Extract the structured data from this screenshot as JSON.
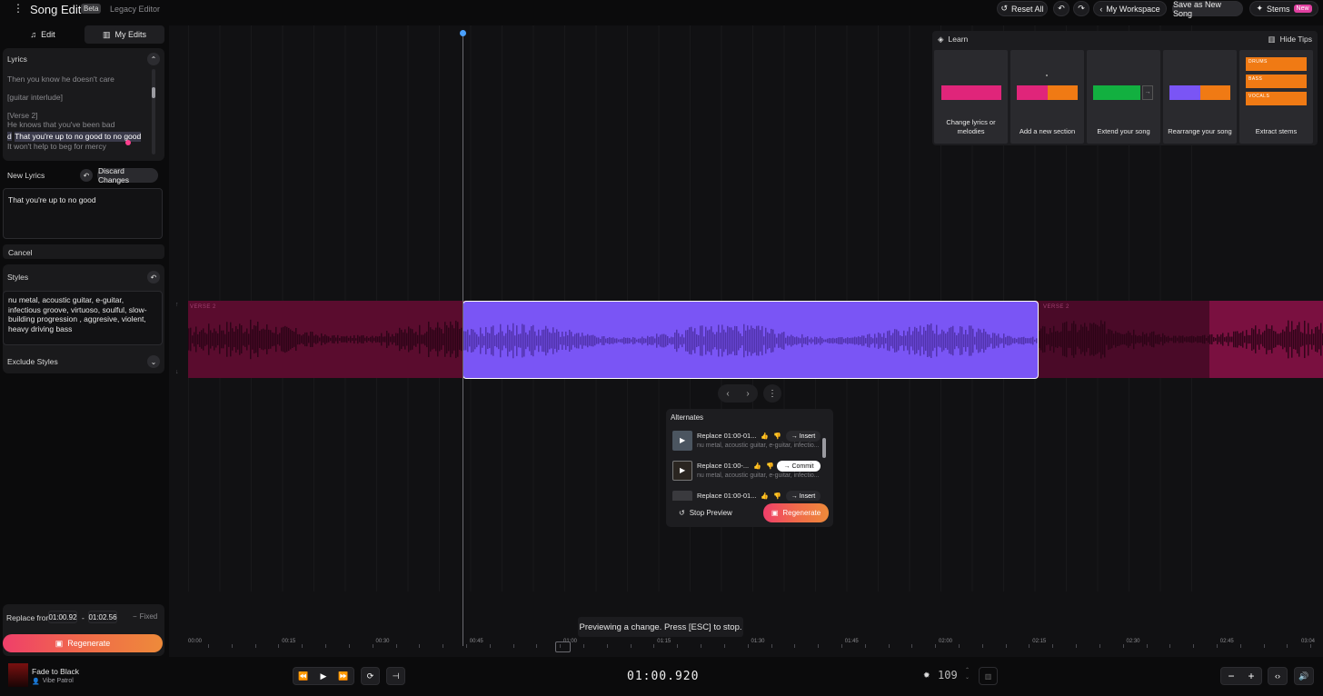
{
  "header": {
    "app_title": "Song Editor",
    "beta_badge": "Beta",
    "legacy_link": "Legacy Editor",
    "reset_all": "Reset All",
    "workspace": "My Workspace",
    "save_new": "Save as New Song",
    "stems": "Stems",
    "stems_badge": "New"
  },
  "left_tabs": {
    "edit": "Edit",
    "my_edits": "My Edits"
  },
  "lyrics": {
    "label": "Lyrics",
    "lines": [
      "Then you know he doesn't care",
      "",
      "[guitar interlude]",
      "",
      "[Verse 2]",
      "He knows that you've been bad",
      "d",
      "That you're up to no good to no good",
      "It won't help to beg for mercy"
    ]
  },
  "new_lyrics": {
    "label": "New Lyrics",
    "discard": "Discard Changes",
    "value": "That you're up to no good",
    "cancel": "Cancel"
  },
  "styles": {
    "label": "Styles",
    "value": "nu metal,  acoustic guitar,  e-guitar,  infectious groove,  virtuoso,  soulful,  slow-building progression , aggresive, violent,  heavy driving bass",
    "exclude_label": "Exclude Styles"
  },
  "replace": {
    "label": "Replace from",
    "from": "01:00.92",
    "sep": "-",
    "to": "01:02.56",
    "mode": "Fixed",
    "regenerate": "Regenerate"
  },
  "learn": {
    "label": "Learn",
    "hide": "Hide Tips",
    "cards": [
      {
        "label": "Change lyrics or melodies"
      },
      {
        "label": "Add a new section"
      },
      {
        "label": "Extend your song"
      },
      {
        "label": "Rearrange your song"
      },
      {
        "label": "Extract stems",
        "stems": [
          "DRUMS",
          "BASS",
          "VOCALS"
        ]
      }
    ]
  },
  "track": {
    "verse_left": "VERSE 2",
    "verse_right": "VERSE 2"
  },
  "alternates": {
    "title": "Alternates",
    "rows": [
      {
        "title": "Replace 01:00-01...",
        "sub": "nu metal, acoustic guitar, e-guitar, infectio...",
        "action": "Insert"
      },
      {
        "title": "Replace 01:00-...",
        "sub": "nu metal, acoustic guitar, e-guitar, infectio...",
        "action": "Commit"
      },
      {
        "title": "Replace 01:00-01...",
        "sub": "",
        "action": "Insert"
      }
    ],
    "stop_preview": "Stop Preview",
    "regenerate": "Regenerate"
  },
  "ruler": {
    "labels": [
      "00:00",
      "00:15",
      "00:30",
      "00:45",
      "01:00",
      "01:15",
      "01:30",
      "01:45",
      "02:00",
      "02:15",
      "02:30",
      "02:45",
      "03:04"
    ]
  },
  "toast": "Previewing a change. Press [ESC] to stop.",
  "player": {
    "song_title": "Fade to Black",
    "artist": "Vibe Patrol",
    "time": "01:00.920",
    "bpm": "109"
  },
  "colors": {
    "accent_purple": "#7a55f5",
    "track_magenta": "#5a0c2e",
    "learn_pink": "#e0257a",
    "learn_orange": "#f07a14",
    "learn_green": "#12b040",
    "learn_purple": "#7a55f5"
  }
}
